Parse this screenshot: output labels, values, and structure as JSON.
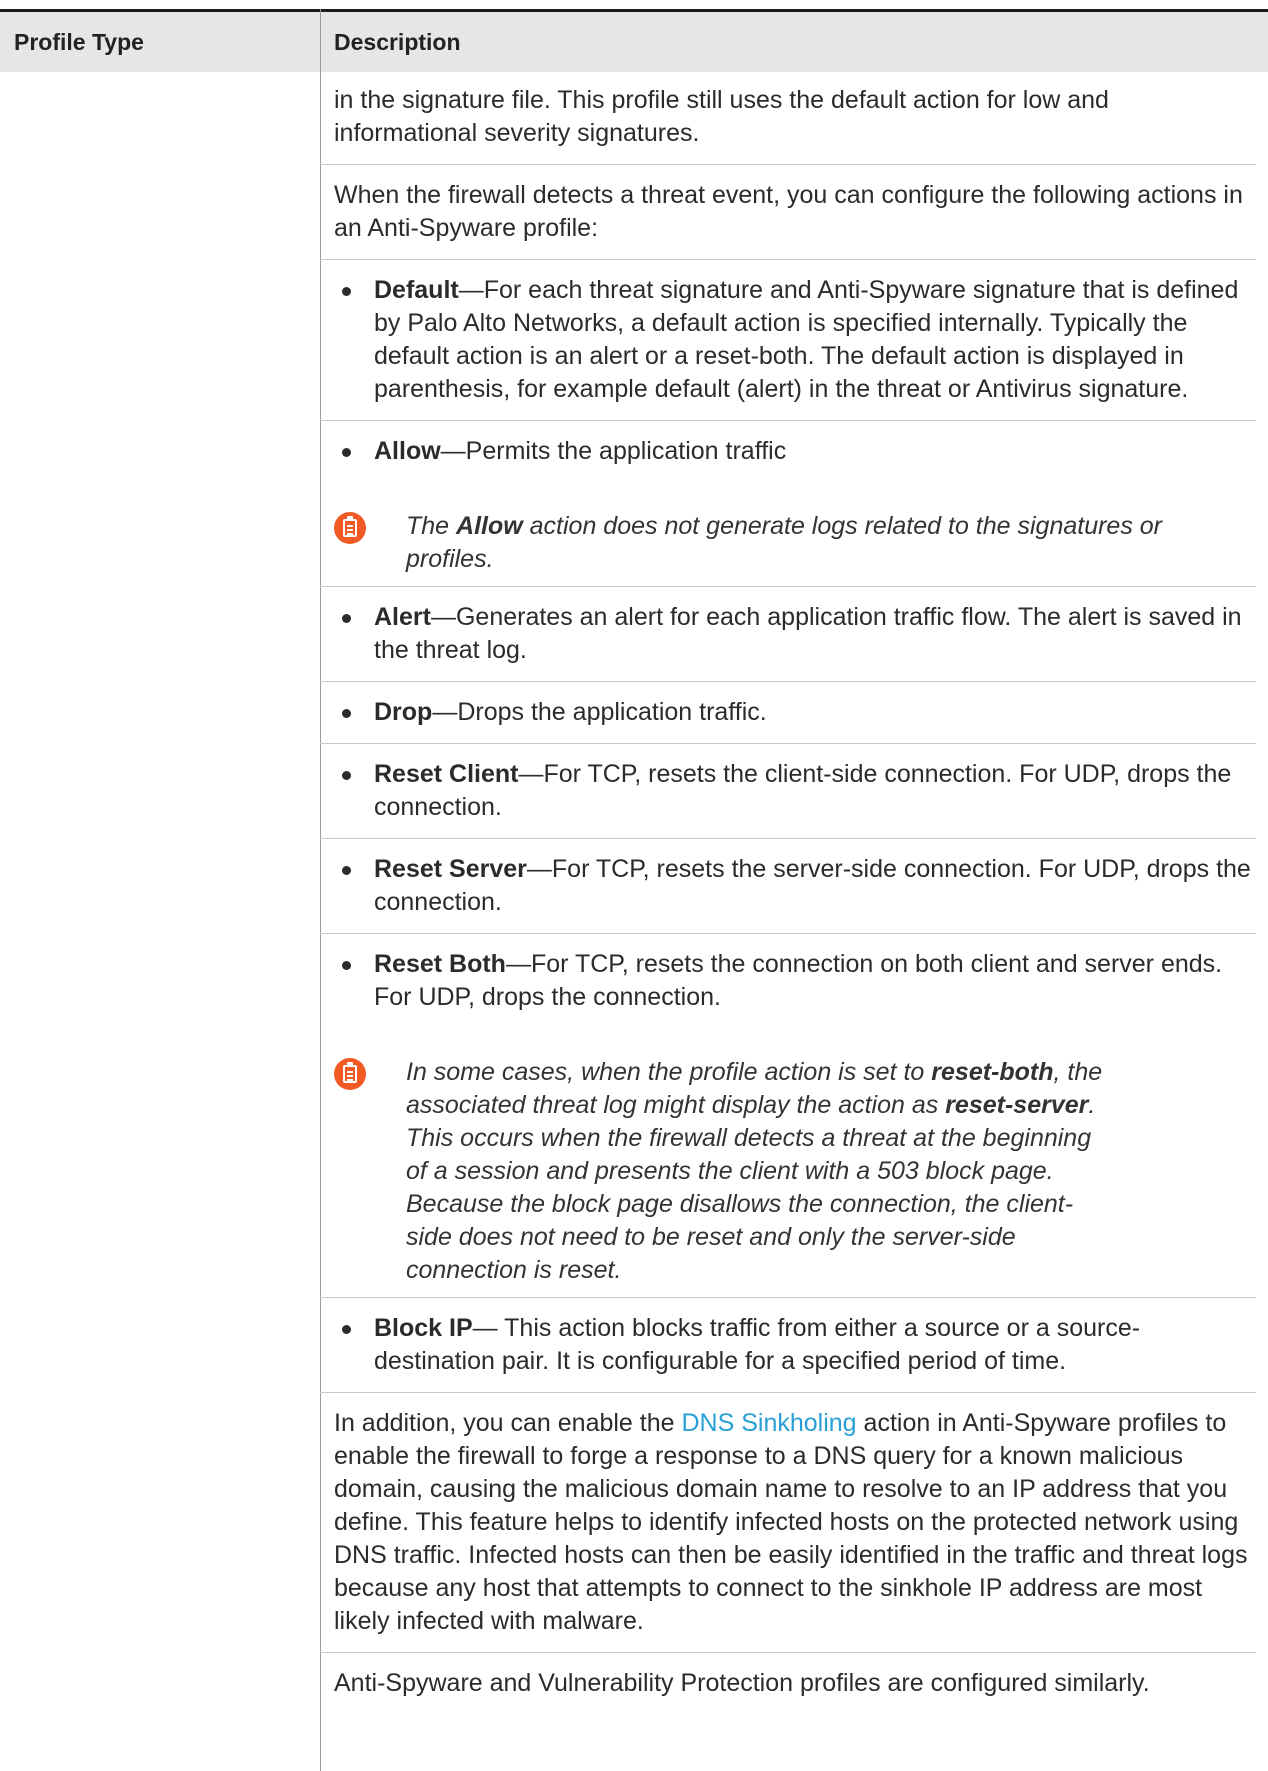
{
  "table": {
    "col_profile_type": "Profile Type",
    "col_description": "Description"
  },
  "content": {
    "intro_continued": "in the signature file. This profile still uses the default action for low and informational severity signatures.",
    "actions_intro": "When the firewall detects a threat event, you can configure the following actions in an Anti-Spyware profile:",
    "bullets": [
      {
        "term": "Default",
        "text": "—For each threat signature and Anti-Spyware signature that is defined by Palo Alto Networks, a default action is specified internally. Typically the default action is an alert or a reset-both. The default action is displayed in parenthesis, for example default (alert) in the threat or Antivirus signature."
      },
      {
        "term": "Allow",
        "text": "—Permits the application traffic"
      },
      {
        "term": "Alert",
        "text": "—Generates an alert for each application traffic flow. The alert is saved in the threat log."
      },
      {
        "term": "Drop",
        "text": "—Drops the application traffic."
      },
      {
        "term": "Reset Client",
        "text": "—For TCP, resets the client-side connection. For UDP, drops the connection."
      },
      {
        "term": "Reset Server",
        "text": "—For TCP, resets the server-side connection. For UDP, drops the connection."
      },
      {
        "term": "Reset Both",
        "text": "—For TCP, resets the connection on both client and server ends. For UDP, drops the connection."
      },
      {
        "term": "Block IP",
        "text": "— This action blocks traffic from either a source or a source-destination pair. It is configurable for a specified period of time."
      }
    ],
    "note1": {
      "pre": "The ",
      "bold": "Allow",
      "post": " action does not generate logs related to the signatures or profiles."
    },
    "note2": {
      "p1": "In some cases, when the profile action is set to ",
      "b1": "reset-both",
      "p2": ", the associated threat log might display the action as ",
      "b2": "reset-server",
      "p3": ". This occurs when the firewall detects a threat at the beginning of a session and presents the client with a 503 block page. Because the block page disallows the connection, the client-side does not need to be reset and only the server-side connection is reset."
    },
    "dns": {
      "pre": "In addition, you can enable the ",
      "link": "DNS Sinkholing",
      "post": " action in Anti-Spyware profiles to enable the firewall to forge a response to a DNS query for a known malicious domain, causing the malicious domain name to resolve to an IP address that you define. This feature helps to identify infected hosts on the protected network using DNS traffic. Infected hosts can then be easily identified in the traffic and threat logs because any host that attempts to connect to the sinkhole IP address are most likely infected with malware."
    },
    "closing": "Anti-Spyware and Vulnerability Protection profiles are configured similarly."
  },
  "colors": {
    "note_icon": "#f15a22",
    "link": "#2a9fd6",
    "header_bg": "#e6e6e6"
  },
  "icons": [
    "note-icon"
  ]
}
